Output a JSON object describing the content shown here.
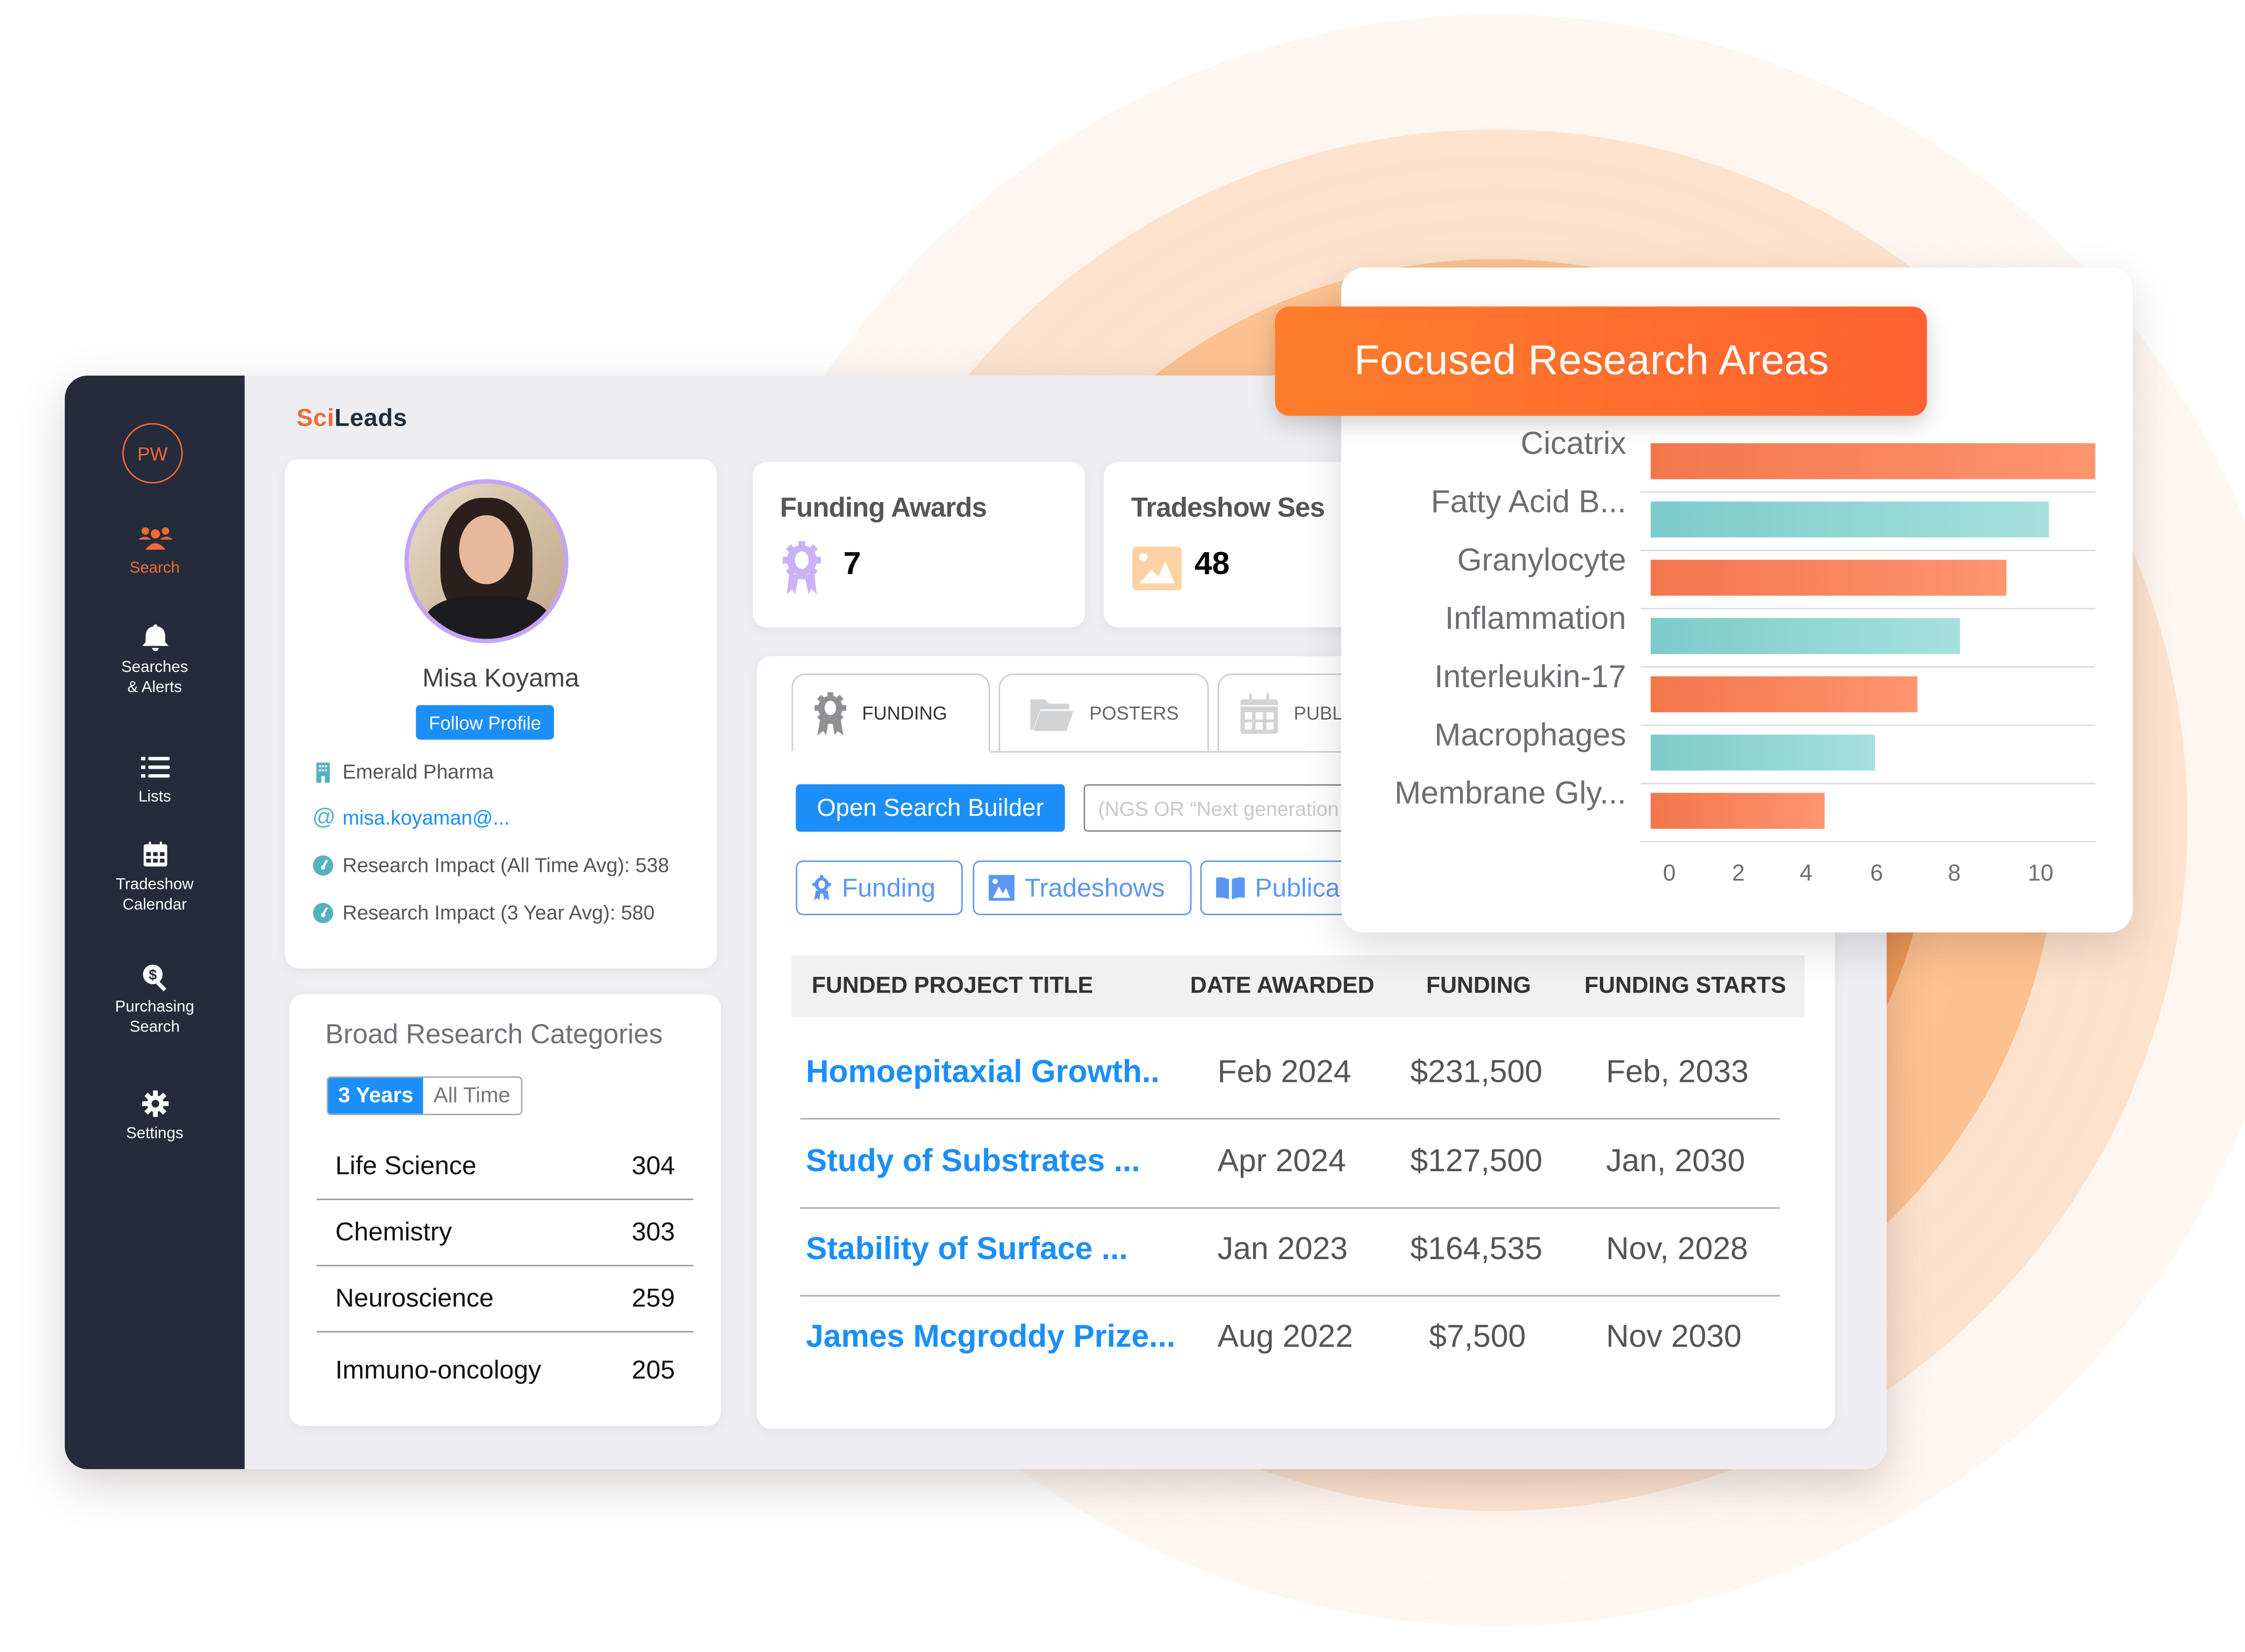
{
  "app": {
    "logo_part1": "Sci",
    "logo_part2": "Leads"
  },
  "sidebar": {
    "user_initials": "PW",
    "items": [
      {
        "label": "Search",
        "icon": "users-icon",
        "active": true
      },
      {
        "label": "Searches\n& Alerts",
        "line1": "Searches",
        "line2": "& Alerts",
        "icon": "bell-icon"
      },
      {
        "label": "Lists",
        "icon": "list-icon"
      },
      {
        "label": "Tradeshow Calendar",
        "line1": "Tradeshow",
        "line2": "Calendar",
        "icon": "calendar-icon"
      },
      {
        "label": "Purchasing Search",
        "line1": "Purchasing",
        "line2": "Search",
        "icon": "dollar-search-icon"
      },
      {
        "label": "Settings",
        "icon": "gear-icon"
      }
    ]
  },
  "profile": {
    "name": "Misa Koyama",
    "follow_label": "Follow Profile",
    "company": "Emerald Pharma",
    "email": "misa.koyaman@...",
    "impact_all_time": "Research Impact (All Time Avg): 538",
    "impact_3_year": "Research Impact (3 Year Avg): 580"
  },
  "broad_categories": {
    "title": "Broad Research Categories",
    "toggle": {
      "selected": "3 Years",
      "other": "All Time"
    },
    "rows": [
      {
        "name": "Life Science",
        "count": "304"
      },
      {
        "name": "Chemistry",
        "count": "303"
      },
      {
        "name": "Neuroscience",
        "count": "259"
      },
      {
        "name": "Immuno-oncology",
        "count": "205"
      }
    ]
  },
  "stats": [
    {
      "title": "Funding Awards",
      "value": "7",
      "icon": "award-icon",
      "color": "#c9b2f8"
    },
    {
      "title": "Tradeshow Ses",
      "value": "48",
      "icon": "image-icon",
      "color": "#fdd3a5"
    }
  ],
  "tabs": [
    {
      "label": "FUNDING",
      "icon": "award-icon",
      "active": true
    },
    {
      "label": "POSTERS",
      "icon": "folder-icon"
    },
    {
      "label": "PUBL",
      "icon": "calendar-icon"
    }
  ],
  "search": {
    "builder_label": "Open Search Builder",
    "placeholder": "(NGS OR “Next generation"
  },
  "filters": [
    {
      "label": "Funding",
      "icon": "award-icon"
    },
    {
      "label": "Tradeshows",
      "icon": "image-icon"
    },
    {
      "label": "Publica",
      "icon": "book-icon"
    }
  ],
  "table": {
    "columns": [
      "FUNDED PROJECT TITLE",
      "DATE AWARDED",
      "FUNDING",
      "FUNDING STARTS"
    ],
    "rows": [
      {
        "title": "Homoepitaxial Growth..",
        "date": "Feb 2024",
        "funding": "$231,500",
        "starts": "Feb, 2033"
      },
      {
        "title": "Study of Substrates ...",
        "date": "Apr 2024",
        "funding": "$127,500",
        "starts": "Jan, 2030"
      },
      {
        "title": "Stability of Surface ...",
        "date": "Jan 2023",
        "funding": "$164,535",
        "starts": "Nov, 2028"
      },
      {
        "title": "James Mcgroddy Prize...",
        "date": "Aug 2022",
        "funding": "$7,500",
        "starts": "Nov 2030"
      }
    ]
  },
  "colors": {
    "accent": "#f26a36",
    "primary_blue": "#1b8ff7",
    "sidebar_bg": "#252b3a",
    "bar_orange": "#f4774d",
    "bar_teal": "#7dcdcc"
  },
  "chart_data": {
    "type": "bar",
    "orientation": "horizontal",
    "title": "Focused Research Areas",
    "categories": [
      "Cicatrix",
      "Fatty Acid B...",
      "Granylocyte",
      "Inflammation",
      "Interleukin-17",
      "Macrophages",
      "Membrane Gly..."
    ],
    "values": [
      11.5,
      10.3,
      9.2,
      8.0,
      6.9,
      5.8,
      4.5
    ],
    "bar_colors": [
      "orange",
      "teal",
      "orange",
      "teal",
      "orange",
      "teal",
      "orange"
    ],
    "xticks": [
      "0",
      "2",
      "4",
      "6",
      "8",
      "10"
    ],
    "xlim": [
      0,
      11.5
    ],
    "xlabel": "",
    "ylabel": "",
    "grid": "horizontal row separators"
  }
}
